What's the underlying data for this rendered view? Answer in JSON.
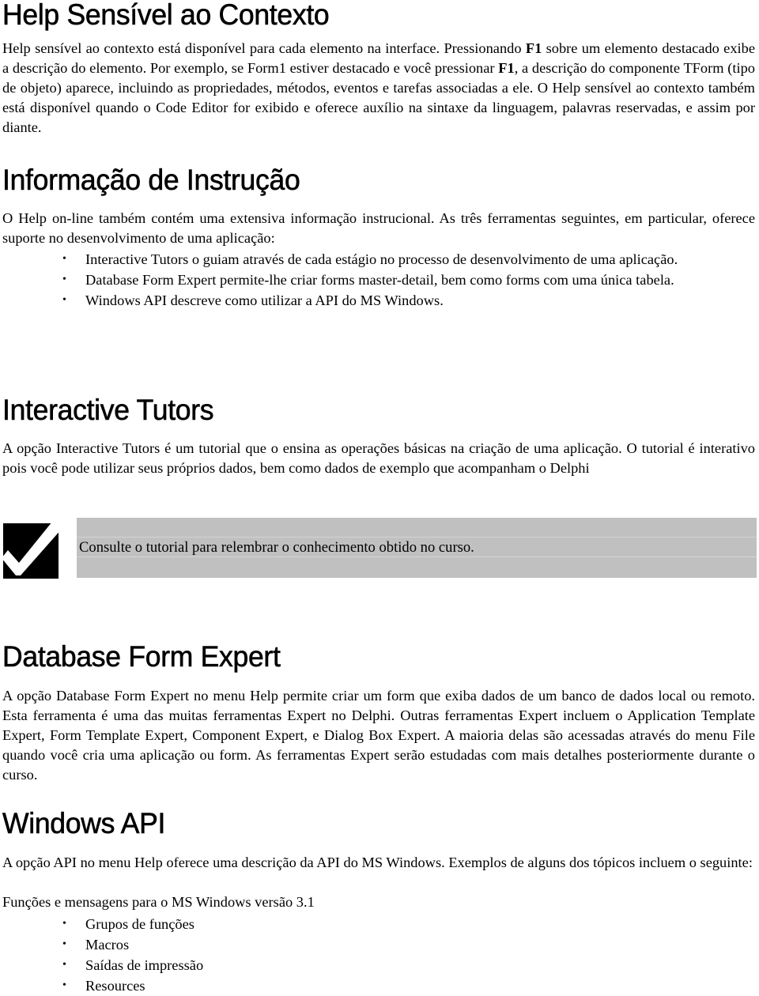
{
  "sections": {
    "help_sensivel": {
      "title": "Help Sensível ao Contexto",
      "para": {
        "t1": "Help sensível ao contexto   está disponível para cada elemento na interface. Pressionando ",
        "b1": "F1",
        "t2": " sobre um elemento destacado exibe a descrição do elemento. Por exemplo, se Form1 estiver destacado e você pressionar ",
        "b2": "F1",
        "t3": ", a descrição do componente TForm (tipo de objeto) aparece, incluindo as propriedades, métodos, eventos e tarefas associadas a ele. O Help sensível ao contexto também está disponível quando o Code Editor for exibido e oferece auxílio na sintaxe da linguagem, palavras reservadas, e assim por diante."
      }
    },
    "informacao": {
      "title": "Informação de Instrução",
      "para": "O Help on-line também contém uma extensiva informação instrucional. As três ferramentas seguintes, em particular, oferece suporte no desenvolvimento de uma aplicação:",
      "bullets": [
        "Interactive Tutors o guiam através de cada estágio no processo de desenvolvimento de uma aplicação.",
        "Database Form Expert permite-lhe criar forms master-detail, bem como forms com uma única tabela.",
        "Windows API descreve como utilizar a API do MS Windows."
      ]
    },
    "interactive_tutors": {
      "title": "Interactive Tutors",
      "para": "A opção  Interactive Tutors é um tutorial que o ensina  as operações básicas na criação de uma aplicação. O tutorial é interativo pois você pode utilizar seus próprios dados, bem como dados de exemplo que acompanham o Delphi",
      "note": {
        "icon": "checkmark-icon",
        "text": "Consulte o tutorial para relembrar o conhecimento obtido no curso."
      }
    },
    "database_form_expert": {
      "title": "Database Form Expert",
      "para": "A opção Database Form Expert no menu Help permite criar um form que exiba dados de um banco de dados local ou remoto. Esta ferramenta é uma das muitas ferramentas Expert no Delphi. Outras ferramentas Expert incluem o  Application Template Expert, Form Template Expert, Component Expert, e Dialog Box Expert. A maioria delas são acessadas através do menu File quando você cria uma aplicação ou form. As ferramentas Expert serão estudadas com mais detalhes posteriormente durante o curso."
    },
    "windows_api": {
      "title": "Windows API",
      "para": "A opção API no menu Help oferece uma descrição da API do MS Windows. Exemplos de alguns dos tópicos incluem o seguinte:",
      "subline": "Funções e mensagens para o MS Windows versão 3.1",
      "bullets": [
        "Grupos de funções",
        "Macros",
        "Saídas de impressão",
        "Resources"
      ]
    }
  },
  "bullet_glyph": "•"
}
